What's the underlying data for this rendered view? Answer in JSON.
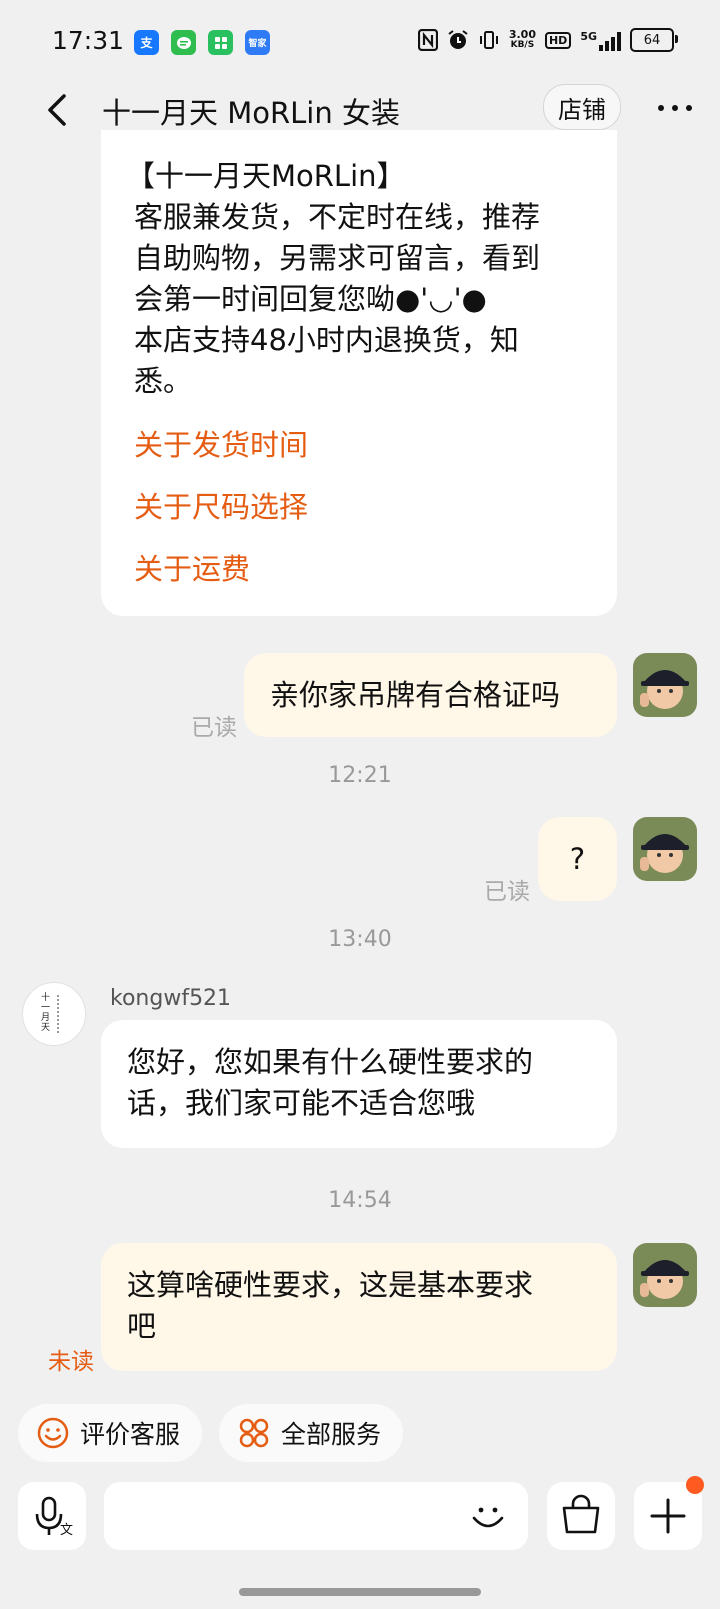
{
  "status_bar": {
    "time": "17:31",
    "apps": [
      {
        "icon": "alipay-icon",
        "glyph": "支",
        "color": "#1677ff"
      },
      {
        "icon": "message-icon",
        "glyph": "",
        "color": "#2fbd50"
      },
      {
        "icon": "grid-app-icon",
        "glyph": "",
        "color": "#29c160"
      },
      {
        "icon": "smart-home-icon",
        "glyph": "智家",
        "color": "#2f7bf6"
      }
    ],
    "speed_value": "3.00",
    "speed_unit": "KB/S",
    "hd": "HD",
    "network": "5G",
    "battery": "64"
  },
  "header": {
    "title": "十一月天 MoRLin 女装",
    "store_button": "店铺"
  },
  "intro": {
    "lines": [
      "【十一月天MoRLin】",
      "客服兼发货，不定时在线，推荐",
      "自助购物，另需求可留言，看到",
      "会第一时间回复您呦●'◡'●",
      "本店支持48小时内退换货，知",
      "悉。"
    ],
    "links": [
      "关于发货时间",
      "关于尺码选择",
      "关于运费"
    ]
  },
  "messages": [
    {
      "text": "亲你家吊牌有合格证吗",
      "status": "已读"
    },
    {
      "timestamp": "12:21"
    },
    {
      "text": "?",
      "status": "已读"
    },
    {
      "timestamp": "13:40"
    },
    {
      "sender": "kongwf521",
      "line1": "您好，您如果有什么硬性要求的",
      "line2": "话，我们家可能不适合您哦"
    },
    {
      "timestamp": "14:54"
    },
    {
      "line1": "这算啥硬性要求，这是基本要求",
      "line2": "吧",
      "status": "未读"
    }
  ],
  "shop_logo_text": "十一月天",
  "quick_actions": [
    {
      "label": "评价客服",
      "icon": "smile-icon"
    },
    {
      "label": "全部服务",
      "icon": "services-grid-icon"
    }
  ],
  "input": {
    "placeholder": ""
  },
  "colors": {
    "accent": "#e55d13",
    "my_bubble": "#fff7e8",
    "background": "#f0f0f0"
  }
}
